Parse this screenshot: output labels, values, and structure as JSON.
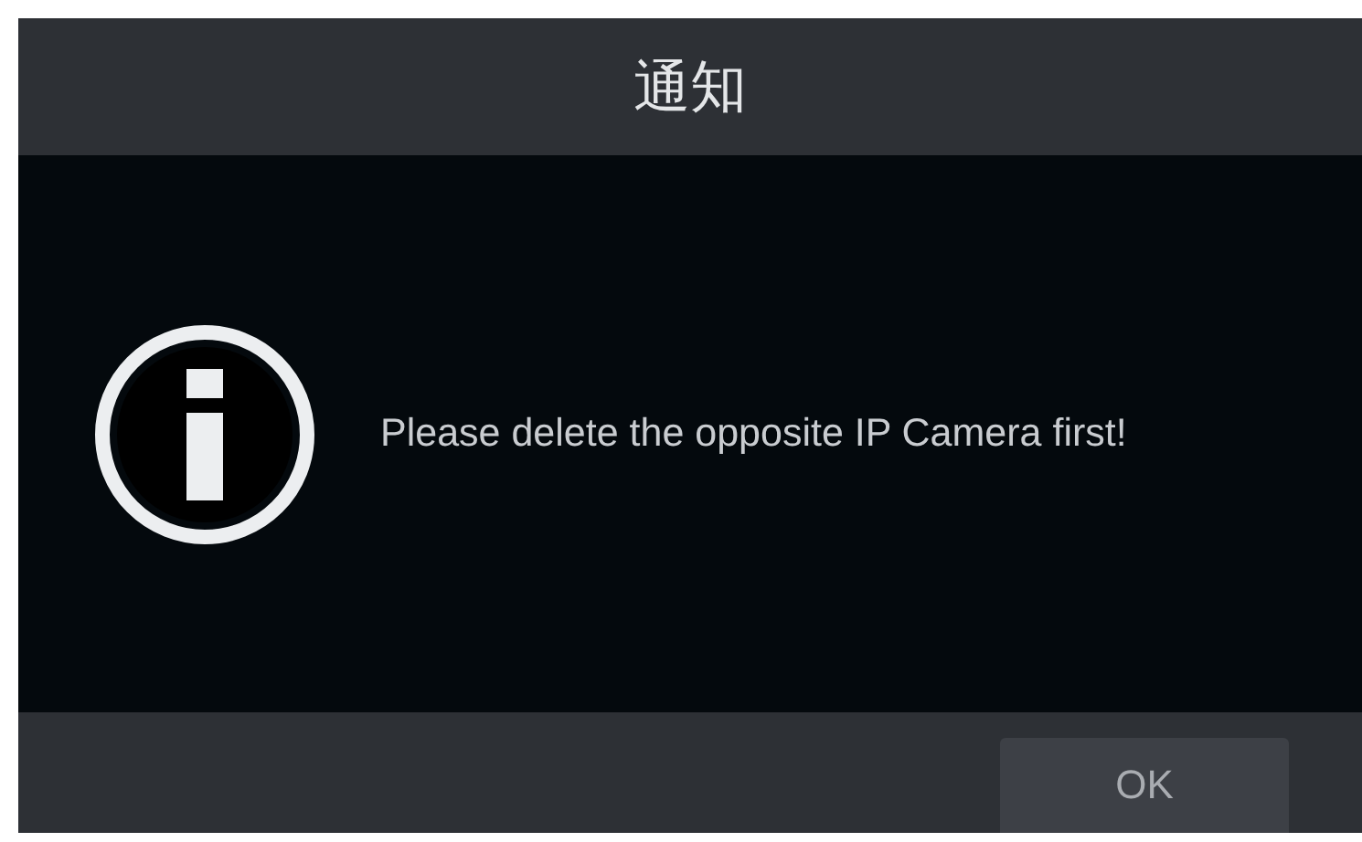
{
  "dialog": {
    "title": "通知",
    "message": "Please delete the opposite IP Camera first!",
    "buttons": [
      "OK"
    ]
  }
}
